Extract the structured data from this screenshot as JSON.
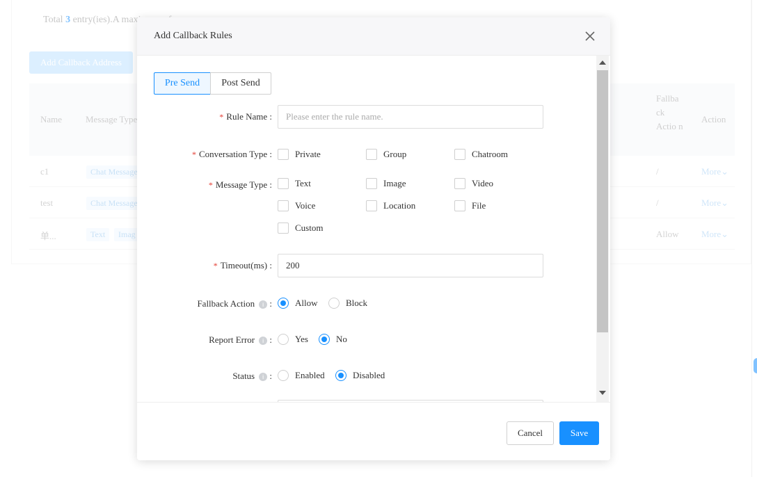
{
  "background": {
    "total_prefix": "Total",
    "total_count": "3",
    "total_suffix": "entry(ies).A maximum of ",
    "add_button": "Add Callback Address",
    "columns": {
      "name": "Name",
      "message_type": "Message Type",
      "fallback_action": "Fallba ck Actio n",
      "action": "Action"
    },
    "rows": [
      {
        "name": "c1",
        "tags": [
          "Chat Message"
        ],
        "fallback": "/",
        "more": "More"
      },
      {
        "name": "test",
        "tags": [
          "Chat Message"
        ],
        "fallback": "/",
        "more": "More"
      },
      {
        "name": "单...",
        "tags": [
          "Text",
          "Imag"
        ],
        "fallback": "Allow",
        "more": "More"
      }
    ]
  },
  "modal": {
    "title": "Add Callback Rules",
    "tabs": [
      "Pre Send",
      "Post Send"
    ],
    "active_tab": "Pre Send",
    "rule_name": {
      "label": "Rule Name",
      "placeholder": "Please enter the rule name.",
      "value": ""
    },
    "conversation_type": {
      "label": "Conversation Type",
      "options": [
        "Private",
        "Group",
        "Chatroom"
      ]
    },
    "message_type": {
      "label": "Message Type",
      "options": [
        "Text",
        "Image",
        "Video",
        "Voice",
        "Location",
        "File",
        "Custom"
      ]
    },
    "timeout": {
      "label": "Timeout(ms)",
      "value": "200"
    },
    "fallback_action": {
      "label": "Fallback Action",
      "options": [
        "Allow",
        "Block"
      ],
      "selected": "Allow"
    },
    "report_error": {
      "label": "Report Error",
      "options": [
        "Yes",
        "No"
      ],
      "selected": "No"
    },
    "status": {
      "label": "Status",
      "options": [
        "Enabled",
        "Disabled"
      ],
      "selected": "Disabled"
    },
    "colon": ":",
    "info_glyph": "i",
    "footer": {
      "cancel": "Cancel",
      "save": "Save"
    }
  },
  "colors": {
    "accent": "#1890ff",
    "required": "#e3392f"
  }
}
